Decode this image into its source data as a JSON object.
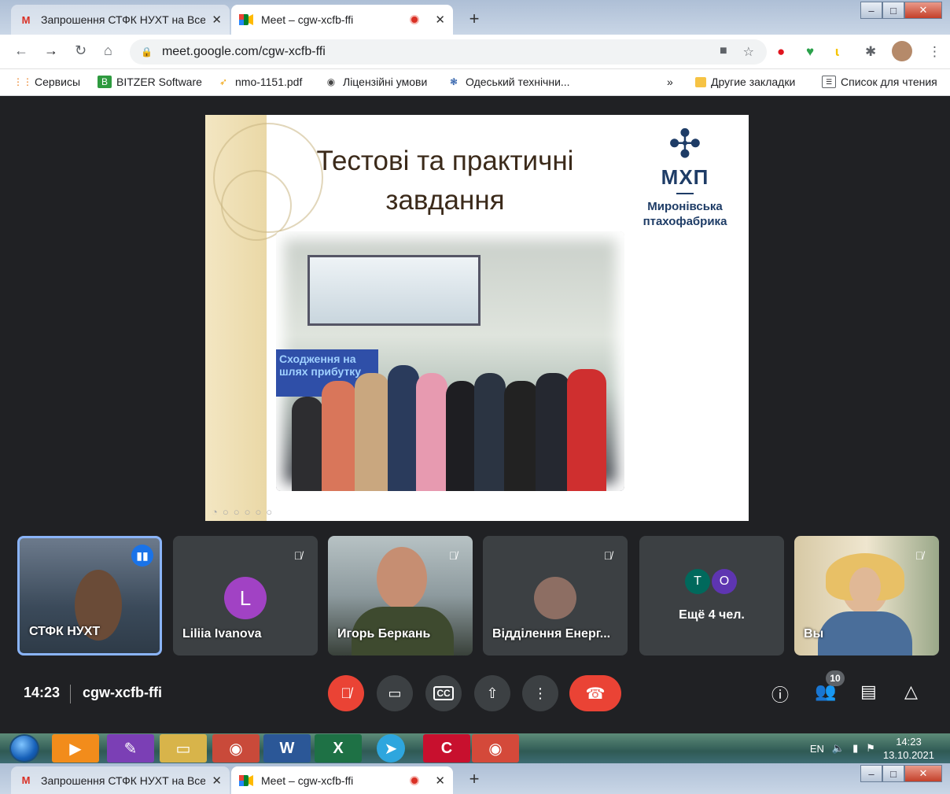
{
  "browser": {
    "tabs": [
      {
        "label": "Запрошення СТФК НУХТ на Все",
        "icon": "gmail-icon",
        "active": false
      },
      {
        "label": "Meet – cgw-xcfb-ffi",
        "icon": "meet-icon",
        "active": true
      }
    ],
    "close_symbol": "✕",
    "new_tab_symbol": "+",
    "url": "meet.google.com/cgw-xcfb-ffi",
    "bookmarks": [
      {
        "label": "Сервисы"
      },
      {
        "label": "BITZER Software"
      },
      {
        "label": "nmo-1151.pdf"
      },
      {
        "label": "Ліцензійні умови"
      },
      {
        "label": "Одеський технічни..."
      }
    ],
    "bookmarks_more": "»",
    "other_bookmarks": "Другие закладки",
    "reading_list": "Список для чтения"
  },
  "slide": {
    "title": "Тестові та практичні завдання",
    "logo_abbr": "МХП",
    "logo_name": "Миронівська птахофабрика",
    "photo_banner": "Сходження на шлях прибутку"
  },
  "participants": [
    {
      "name": "СТФК НУХТ",
      "speaking": true
    },
    {
      "name": "Liliia Ivanova",
      "initial": "L",
      "avatar_color": "#a142c4"
    },
    {
      "name": "Игорь Беркань"
    },
    {
      "name": "Відділення Енерг..."
    },
    {
      "name": "Ещё 4 чел.",
      "initials": [
        "T",
        "O"
      ]
    },
    {
      "name": "Вы"
    }
  ],
  "meeting": {
    "time": "14:23",
    "code": "cgw-xcfb-ffi",
    "people_count": "10"
  },
  "taskbar": {
    "lang": "EN",
    "clock_time": "14:23",
    "clock_date": "13.10.2021"
  },
  "colors": {
    "meet_bg": "#202124",
    "tile_bg": "#3c4043",
    "end_call": "#ea4335",
    "accent": "#1a73e8"
  }
}
